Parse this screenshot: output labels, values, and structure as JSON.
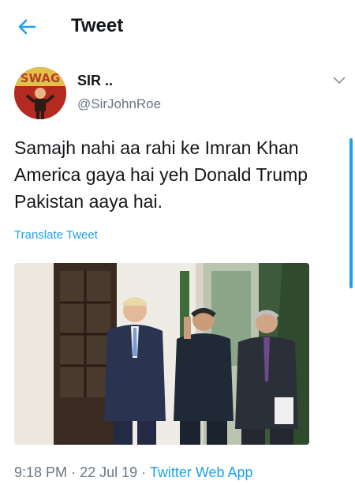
{
  "header": {
    "title": "Tweet",
    "back_icon": "arrow-left-icon"
  },
  "author": {
    "name": "SIR ..",
    "handle": "@SirJohnRoe",
    "avatar_text": "SWAG"
  },
  "tweet": {
    "text": "Samajh nahi aa rahi ke Imran Khan America gaya hai yeh Donald Trump Pakistan aaya hai.",
    "translate_label": "Translate Tweet"
  },
  "meta": {
    "time": "9:18 PM",
    "separator": "·",
    "date": "22 Jul 19",
    "source": "Twitter Web App"
  },
  "colors": {
    "accent": "#1da1f2",
    "text": "#14171a",
    "secondary": "#657786"
  }
}
